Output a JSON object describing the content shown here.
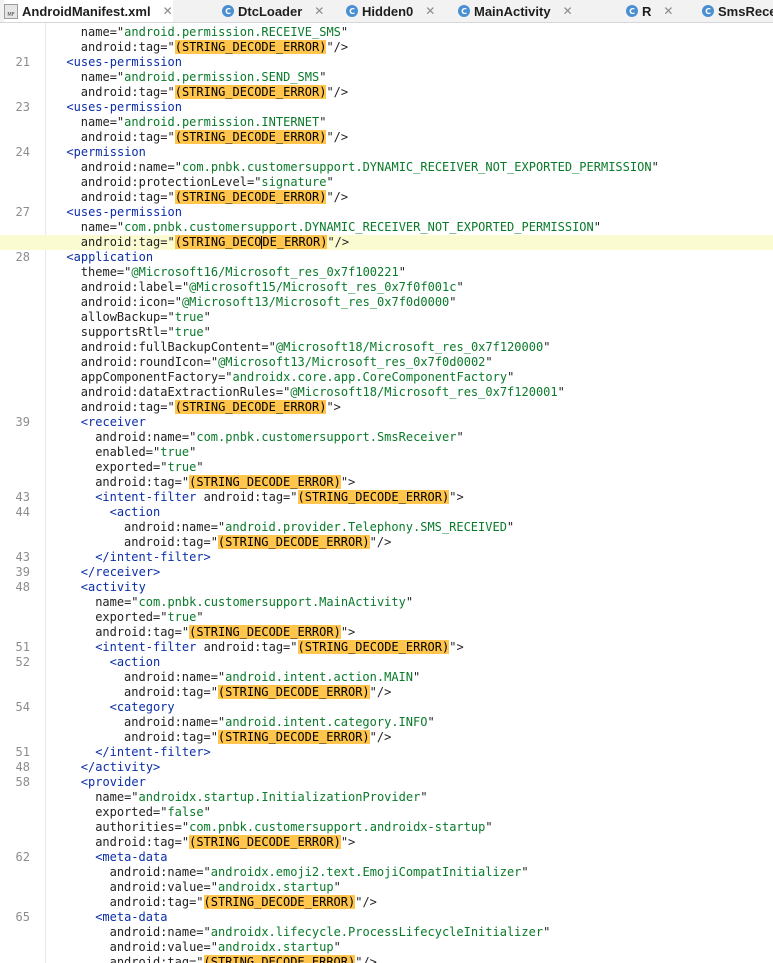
{
  "tabs": [
    {
      "label": "AndroidManifest.xml",
      "icon": "manifest-file-icon",
      "active": true
    },
    {
      "label": "DtcLoader",
      "icon": "class-c-icon",
      "active": false
    },
    {
      "label": "Hidden0",
      "icon": "class-c-icon",
      "active": false
    },
    {
      "label": "MainActivity",
      "icon": "class-c-icon",
      "active": false
    },
    {
      "label": "R",
      "icon": "class-c-icon",
      "active": false
    },
    {
      "label": "SmsRece",
      "icon": "class-c-icon",
      "active": false
    }
  ],
  "colors": {
    "tag": "#0b2ea8",
    "string": "#0a7a2a",
    "error_highlight": "#ffc54d",
    "current_line": "#fbfbd2"
  },
  "current_line_index": 14,
  "lines": [
    {
      "n": "",
      "indent": 4,
      "segs": [
        [
          "a",
          "name=\""
        ],
        [
          "s",
          "android.permission.RECEIVE_SMS"
        ],
        [
          "a",
          "\""
        ]
      ]
    },
    {
      "n": "",
      "indent": 4,
      "segs": [
        [
          "a",
          "android:tag=\""
        ],
        [
          "e",
          "(STRING_DECODE_ERROR)"
        ],
        [
          "a",
          "\"/>"
        ]
      ]
    },
    {
      "n": "21",
      "indent": 2,
      "segs": [
        [
          "t",
          "<uses-permission"
        ]
      ]
    },
    {
      "n": "",
      "indent": 4,
      "segs": [
        [
          "a",
          "name=\""
        ],
        [
          "s",
          "android.permission.SEND_SMS"
        ],
        [
          "a",
          "\""
        ]
      ]
    },
    {
      "n": "",
      "indent": 4,
      "segs": [
        [
          "a",
          "android:tag=\""
        ],
        [
          "e",
          "(STRING_DECODE_ERROR)"
        ],
        [
          "a",
          "\"/>"
        ]
      ]
    },
    {
      "n": "23",
      "indent": 2,
      "segs": [
        [
          "t",
          "<uses-permission"
        ]
      ]
    },
    {
      "n": "",
      "indent": 4,
      "segs": [
        [
          "a",
          "name=\""
        ],
        [
          "s",
          "android.permission.INTERNET"
        ],
        [
          "a",
          "\""
        ]
      ]
    },
    {
      "n": "",
      "indent": 4,
      "segs": [
        [
          "a",
          "android:tag=\""
        ],
        [
          "e",
          "(STRING_DECODE_ERROR)"
        ],
        [
          "a",
          "\"/>"
        ]
      ]
    },
    {
      "n": "24",
      "indent": 2,
      "segs": [
        [
          "t",
          "<permission"
        ]
      ]
    },
    {
      "n": "",
      "indent": 4,
      "segs": [
        [
          "a",
          "android:name=\""
        ],
        [
          "s",
          "com.pnbk.customersupport.DYNAMIC_RECEIVER_NOT_EXPORTED_PERMISSION"
        ],
        [
          "a",
          "\""
        ]
      ]
    },
    {
      "n": "",
      "indent": 4,
      "segs": [
        [
          "a",
          "android:protectionLevel=\""
        ],
        [
          "s",
          "signature"
        ],
        [
          "a",
          "\""
        ]
      ]
    },
    {
      "n": "",
      "indent": 4,
      "segs": [
        [
          "a",
          "android:tag=\""
        ],
        [
          "e",
          "(STRING_DECODE_ERROR)"
        ],
        [
          "a",
          "\"/>"
        ]
      ]
    },
    {
      "n": "27",
      "indent": 2,
      "segs": [
        [
          "t",
          "<uses-permission"
        ]
      ]
    },
    {
      "n": "",
      "indent": 4,
      "segs": [
        [
          "a",
          "name=\""
        ],
        [
          "s",
          "com.pnbk.customersupport.DYNAMIC_RECEIVER_NOT_EXPORTED_PERMISSION"
        ],
        [
          "a",
          "\""
        ]
      ]
    },
    {
      "n": "",
      "indent": 4,
      "segs": [
        [
          "a",
          "android:tag=\""
        ],
        [
          "e",
          "(STRING_DECO"
        ],
        [
          "c",
          ""
        ],
        [
          "e",
          "DE_ERROR)"
        ],
        [
          "a",
          "\"/>"
        ]
      ]
    },
    {
      "n": "28",
      "indent": 2,
      "segs": [
        [
          "t",
          "<application"
        ]
      ]
    },
    {
      "n": "",
      "indent": 4,
      "segs": [
        [
          "a",
          "theme=\""
        ],
        [
          "s",
          "@Microsoft16/Microsoft_res_0x7f100221"
        ],
        [
          "a",
          "\""
        ]
      ]
    },
    {
      "n": "",
      "indent": 4,
      "segs": [
        [
          "a",
          "android:label=\""
        ],
        [
          "s",
          "@Microsoft15/Microsoft_res_0x7f0f001c"
        ],
        [
          "a",
          "\""
        ]
      ]
    },
    {
      "n": "",
      "indent": 4,
      "segs": [
        [
          "a",
          "android:icon=\""
        ],
        [
          "s",
          "@Microsoft13/Microsoft_res_0x7f0d0000"
        ],
        [
          "a",
          "\""
        ]
      ]
    },
    {
      "n": "",
      "indent": 4,
      "segs": [
        [
          "a",
          "allowBackup=\""
        ],
        [
          "s",
          "true"
        ],
        [
          "a",
          "\""
        ]
      ]
    },
    {
      "n": "",
      "indent": 4,
      "segs": [
        [
          "a",
          "supportsRtl=\""
        ],
        [
          "s",
          "true"
        ],
        [
          "a",
          "\""
        ]
      ]
    },
    {
      "n": "",
      "indent": 4,
      "segs": [
        [
          "a",
          "android:fullBackupContent=\""
        ],
        [
          "s",
          "@Microsoft18/Microsoft_res_0x7f120000"
        ],
        [
          "a",
          "\""
        ]
      ]
    },
    {
      "n": "",
      "indent": 4,
      "segs": [
        [
          "a",
          "android:roundIcon=\""
        ],
        [
          "s",
          "@Microsoft13/Microsoft_res_0x7f0d0002"
        ],
        [
          "a",
          "\""
        ]
      ]
    },
    {
      "n": "",
      "indent": 4,
      "segs": [
        [
          "a",
          "appComponentFactory=\""
        ],
        [
          "s",
          "androidx.core.app.CoreComponentFactory"
        ],
        [
          "a",
          "\""
        ]
      ]
    },
    {
      "n": "",
      "indent": 4,
      "segs": [
        [
          "a",
          "android:dataExtractionRules=\""
        ],
        [
          "s",
          "@Microsoft18/Microsoft_res_0x7f120001"
        ],
        [
          "a",
          "\""
        ]
      ]
    },
    {
      "n": "",
      "indent": 4,
      "segs": [
        [
          "a",
          "android:tag=\""
        ],
        [
          "e",
          "(STRING_DECODE_ERROR)"
        ],
        [
          "a",
          "\">"
        ]
      ]
    },
    {
      "n": "39",
      "indent": 4,
      "segs": [
        [
          "t",
          "<receiver"
        ]
      ]
    },
    {
      "n": "",
      "indent": 6,
      "segs": [
        [
          "a",
          "android:name=\""
        ],
        [
          "s",
          "com.pnbk.customersupport.SmsReceiver"
        ],
        [
          "a",
          "\""
        ]
      ]
    },
    {
      "n": "",
      "indent": 6,
      "segs": [
        [
          "a",
          "enabled=\""
        ],
        [
          "s",
          "true"
        ],
        [
          "a",
          "\""
        ]
      ]
    },
    {
      "n": "",
      "indent": 6,
      "segs": [
        [
          "a",
          "exported=\""
        ],
        [
          "s",
          "true"
        ],
        [
          "a",
          "\""
        ]
      ]
    },
    {
      "n": "",
      "indent": 6,
      "segs": [
        [
          "a",
          "android:tag=\""
        ],
        [
          "e",
          "(STRING_DECODE_ERROR)"
        ],
        [
          "a",
          "\">"
        ]
      ]
    },
    {
      "n": "43",
      "indent": 6,
      "segs": [
        [
          "t",
          "<intent-filter"
        ],
        [
          "a",
          " android:tag=\""
        ],
        [
          "e",
          "(STRING_DECODE_ERROR)"
        ],
        [
          "a",
          "\">"
        ]
      ]
    },
    {
      "n": "44",
      "indent": 8,
      "segs": [
        [
          "t",
          "<action"
        ]
      ]
    },
    {
      "n": "",
      "indent": 10,
      "segs": [
        [
          "a",
          "android:name=\""
        ],
        [
          "s",
          "android.provider.Telephony.SMS_RECEIVED"
        ],
        [
          "a",
          "\""
        ]
      ]
    },
    {
      "n": "",
      "indent": 10,
      "segs": [
        [
          "a",
          "android:tag=\""
        ],
        [
          "e",
          "(STRING_DECODE_ERROR)"
        ],
        [
          "a",
          "\"/>"
        ]
      ]
    },
    {
      "n": "43",
      "indent": 6,
      "segs": [
        [
          "t",
          "</intent-filter>"
        ]
      ]
    },
    {
      "n": "39",
      "indent": 4,
      "segs": [
        [
          "t",
          "</receiver>"
        ]
      ]
    },
    {
      "n": "48",
      "indent": 4,
      "segs": [
        [
          "t",
          "<activity"
        ]
      ]
    },
    {
      "n": "",
      "indent": 6,
      "segs": [
        [
          "a",
          "name=\""
        ],
        [
          "s",
          "com.pnbk.customersupport.MainActivity"
        ],
        [
          "a",
          "\""
        ]
      ]
    },
    {
      "n": "",
      "indent": 6,
      "segs": [
        [
          "a",
          "exported=\""
        ],
        [
          "s",
          "true"
        ],
        [
          "a",
          "\""
        ]
      ]
    },
    {
      "n": "",
      "indent": 6,
      "segs": [
        [
          "a",
          "android:tag=\""
        ],
        [
          "e",
          "(STRING_DECODE_ERROR)"
        ],
        [
          "a",
          "\">"
        ]
      ]
    },
    {
      "n": "51",
      "indent": 6,
      "segs": [
        [
          "t",
          "<intent-filter"
        ],
        [
          "a",
          " android:tag=\""
        ],
        [
          "e",
          "(STRING_DECODE_ERROR)"
        ],
        [
          "a",
          "\">"
        ]
      ]
    },
    {
      "n": "52",
      "indent": 8,
      "segs": [
        [
          "t",
          "<action"
        ]
      ]
    },
    {
      "n": "",
      "indent": 10,
      "segs": [
        [
          "a",
          "android:name=\""
        ],
        [
          "s",
          "android.intent.action.MAIN"
        ],
        [
          "a",
          "\""
        ]
      ]
    },
    {
      "n": "",
      "indent": 10,
      "segs": [
        [
          "a",
          "android:tag=\""
        ],
        [
          "e",
          "(STRING_DECODE_ERROR)"
        ],
        [
          "a",
          "\"/>"
        ]
      ]
    },
    {
      "n": "54",
      "indent": 8,
      "segs": [
        [
          "t",
          "<category"
        ]
      ]
    },
    {
      "n": "",
      "indent": 10,
      "segs": [
        [
          "a",
          "android:name=\""
        ],
        [
          "s",
          "android.intent.category.INFO"
        ],
        [
          "a",
          "\""
        ]
      ]
    },
    {
      "n": "",
      "indent": 10,
      "segs": [
        [
          "a",
          "android:tag=\""
        ],
        [
          "e",
          "(STRING_DECODE_ERROR)"
        ],
        [
          "a",
          "\"/>"
        ]
      ]
    },
    {
      "n": "51",
      "indent": 6,
      "segs": [
        [
          "t",
          "</intent-filter>"
        ]
      ]
    },
    {
      "n": "48",
      "indent": 4,
      "segs": [
        [
          "t",
          "</activity>"
        ]
      ]
    },
    {
      "n": "58",
      "indent": 4,
      "segs": [
        [
          "t",
          "<provider"
        ]
      ]
    },
    {
      "n": "",
      "indent": 6,
      "segs": [
        [
          "a",
          "name=\""
        ],
        [
          "s",
          "androidx.startup.InitializationProvider"
        ],
        [
          "a",
          "\""
        ]
      ]
    },
    {
      "n": "",
      "indent": 6,
      "segs": [
        [
          "a",
          "exported=\""
        ],
        [
          "s",
          "false"
        ],
        [
          "a",
          "\""
        ]
      ]
    },
    {
      "n": "",
      "indent": 6,
      "segs": [
        [
          "a",
          "authorities=\""
        ],
        [
          "s",
          "com.pnbk.customersupport.androidx-startup"
        ],
        [
          "a",
          "\""
        ]
      ]
    },
    {
      "n": "",
      "indent": 6,
      "segs": [
        [
          "a",
          "android:tag=\""
        ],
        [
          "e",
          "(STRING_DECODE_ERROR)"
        ],
        [
          "a",
          "\">"
        ]
      ]
    },
    {
      "n": "62",
      "indent": 6,
      "segs": [
        [
          "t",
          "<meta-data"
        ]
      ]
    },
    {
      "n": "",
      "indent": 8,
      "segs": [
        [
          "a",
          "android:name=\""
        ],
        [
          "s",
          "androidx.emoji2.text.EmojiCompatInitializer"
        ],
        [
          "a",
          "\""
        ]
      ]
    },
    {
      "n": "",
      "indent": 8,
      "segs": [
        [
          "a",
          "android:value=\""
        ],
        [
          "s",
          "androidx.startup"
        ],
        [
          "a",
          "\""
        ]
      ]
    },
    {
      "n": "",
      "indent": 8,
      "segs": [
        [
          "a",
          "android:tag=\""
        ],
        [
          "e",
          "(STRING_DECODE_ERROR)"
        ],
        [
          "a",
          "\"/>"
        ]
      ]
    },
    {
      "n": "65",
      "indent": 6,
      "segs": [
        [
          "t",
          "<meta-data"
        ]
      ]
    },
    {
      "n": "",
      "indent": 8,
      "segs": [
        [
          "a",
          "android:name=\""
        ],
        [
          "s",
          "androidx.lifecycle.ProcessLifecycleInitializer"
        ],
        [
          "a",
          "\""
        ]
      ]
    },
    {
      "n": "",
      "indent": 8,
      "segs": [
        [
          "a",
          "android:value=\""
        ],
        [
          "s",
          "androidx.startup"
        ],
        [
          "a",
          "\""
        ]
      ]
    },
    {
      "n": "",
      "indent": 8,
      "segs": [
        [
          "a",
          "android:tag=\""
        ],
        [
          "e",
          "(STRING_DECODE_ERROR)"
        ],
        [
          "a",
          "\"/>"
        ]
      ]
    }
  ]
}
